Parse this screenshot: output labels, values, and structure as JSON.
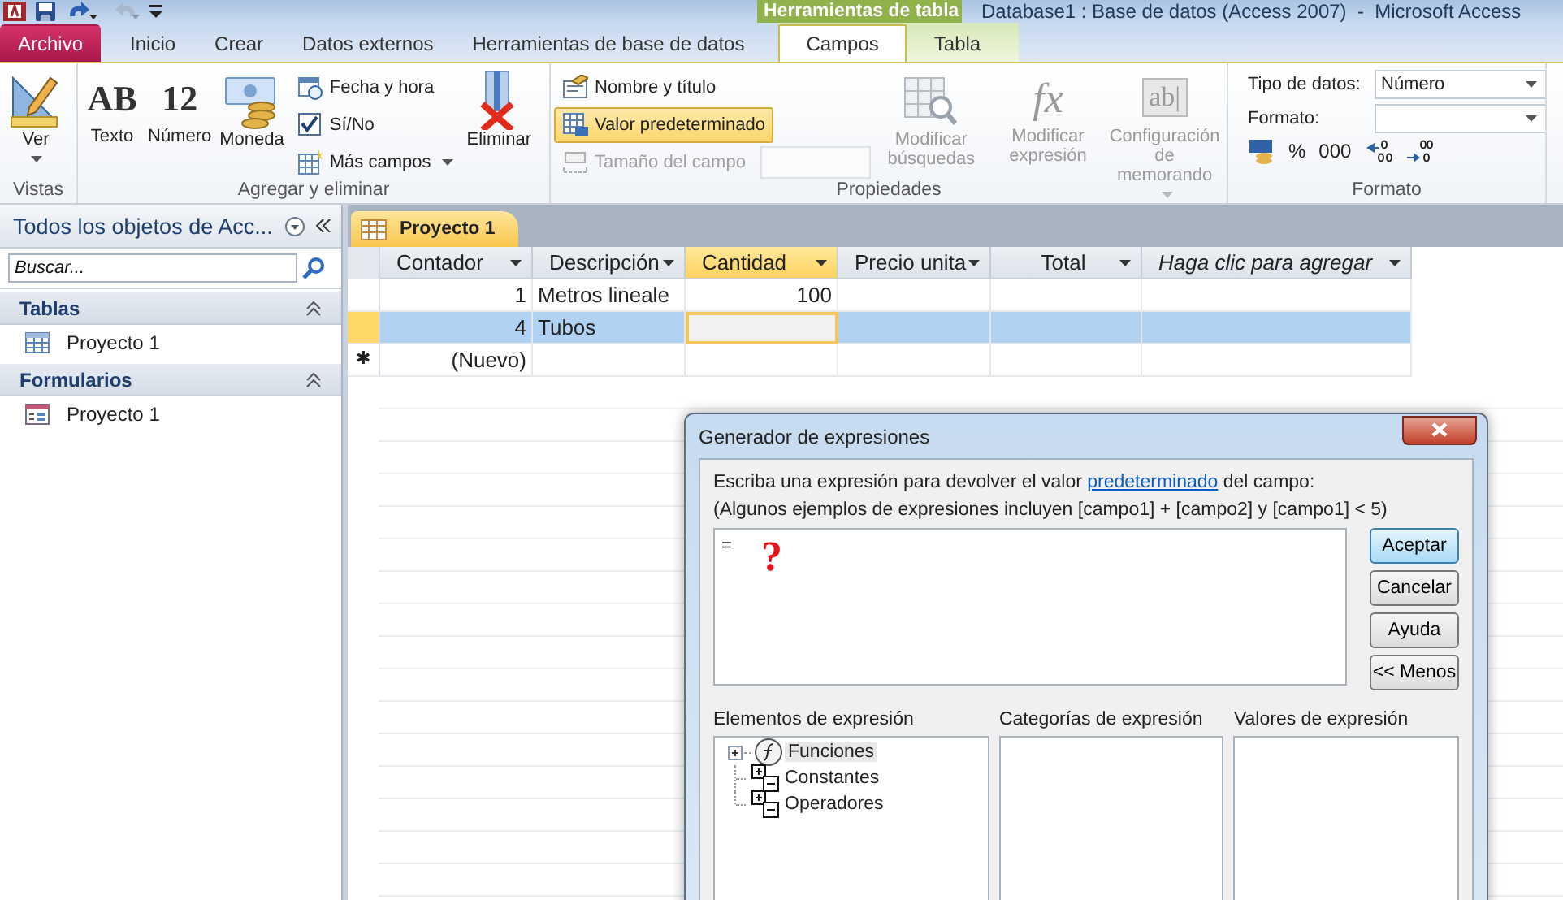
{
  "title_bar": {
    "contextual_tab": "Herramientas de tabla",
    "title": "Database1 : Base de datos (Access 2007)  -  Microsoft Access"
  },
  "ribbon_tabs": [
    {
      "label": "Archivo",
      "kind": "file",
      "selected": false
    },
    {
      "label": "Inicio",
      "kind": "normal",
      "selected": false
    },
    {
      "label": "Crear",
      "kind": "normal",
      "selected": false
    },
    {
      "label": "Datos externos",
      "kind": "normal",
      "selected": false
    },
    {
      "label": "Herramientas de base de datos",
      "kind": "normal",
      "selected": false
    },
    {
      "label": "Campos",
      "kind": "contextual",
      "selected": true
    },
    {
      "label": "Tabla",
      "kind": "contextual",
      "selected": false
    }
  ],
  "ribbon_groups": [
    {
      "label": "Vistas",
      "controls": [
        {
          "kind": "large",
          "label": "Ver",
          "dropdown": true,
          "disabled": false
        }
      ]
    },
    {
      "label": "Agregar y eliminar",
      "controls": [
        {
          "kind": "large",
          "label": "Texto",
          "glyph": "AB",
          "disabled": false
        },
        {
          "kind": "large",
          "label": "Número",
          "glyph": "12",
          "disabled": false
        },
        {
          "kind": "large",
          "label": "Moneda",
          "disabled": false
        },
        {
          "kind": "stack",
          "items": [
            {
              "label": "Fecha y hora",
              "pressed": false,
              "disabled": false
            },
            {
              "label": "Sí/No",
              "pressed": false,
              "disabled": false
            },
            {
              "label": "Más campos",
              "dropdown": true,
              "pressed": false,
              "disabled": false
            }
          ]
        },
        {
          "kind": "large",
          "label": "Eliminar",
          "disabled": false
        }
      ]
    },
    {
      "label": "Propiedades",
      "controls": [
        {
          "kind": "stack",
          "items": [
            {
              "label": "Nombre y título",
              "pressed": false,
              "disabled": false
            },
            {
              "label": "Valor predeterminado",
              "pressed": true,
              "disabled": false
            },
            {
              "label": "Tamaño del campo",
              "pressed": false,
              "disabled": true,
              "field": true
            }
          ]
        },
        {
          "kind": "large",
          "label": "Modificar búsquedas",
          "disabled": true
        },
        {
          "kind": "large",
          "label": "Modificar expresión",
          "glyph": "fx",
          "disabled": true
        },
        {
          "kind": "large",
          "label": "Configuración de memorando",
          "glyph": "ab|",
          "dropdown": true,
          "disabled": true
        }
      ]
    },
    {
      "label": "Formato",
      "controls": [
        {
          "kind": "format",
          "fields": [
            {
              "label": "Tipo de datos:",
              "value": "Número"
            },
            {
              "label": "Formato:"
            }
          ],
          "buttons": [
            {
              "kind": "currency"
            },
            {
              "kind": "text",
              "glyph": "%"
            },
            {
              "kind": "text",
              "glyph": "000"
            },
            {
              "kind": "decimals_more"
            },
            {
              "kind": "decimals_less"
            }
          ]
        }
      ]
    }
  ],
  "nav_pane": {
    "title": "Todos los objetos de Acc...",
    "search": {
      "placeholder": "Buscar..."
    },
    "sections": [
      {
        "label": "Tablas",
        "expanded": true,
        "items": [
          {
            "label": "Proyecto 1",
            "kind": "table"
          }
        ]
      },
      {
        "label": "Formularios",
        "expanded": true,
        "items": [
          {
            "label": "Proyecto 1",
            "kind": "form"
          }
        ]
      }
    ]
  },
  "document_tab": {
    "label": "Proyecto 1"
  },
  "table": {
    "columns": [
      {
        "label": "Contador",
        "kind": "number",
        "selected": false
      },
      {
        "label": "Descripción",
        "kind": "text",
        "selected": false
      },
      {
        "label": "Cantidad",
        "kind": "number",
        "selected": true
      },
      {
        "label": "Precio unita",
        "kind": "text",
        "selected": false
      },
      {
        "label": "Total",
        "kind": "center",
        "selected": false
      },
      {
        "label": "Haga clic para agregar",
        "kind": "add",
        "selected": false
      }
    ],
    "rows": [
      {
        "selected": false,
        "cells": [
          "1",
          "Metros lineale",
          "100",
          "",
          "",
          ""
        ]
      },
      {
        "selected": true,
        "cells": [
          "4",
          "Tubos",
          "",
          "",
          "",
          ""
        ]
      },
      {
        "selector": "✱",
        "selected": false,
        "cells": [
          "(Nuevo)",
          "",
          "",
          "",
          "",
          ""
        ]
      }
    ]
  },
  "dialog": {
    "title": "Generador de expresiones",
    "instruction": "Escriba una expresión para devolver el valor ",
    "link": "predeterminado",
    "instruction_end": " del campo:",
    "examples": "(Algunos ejemplos de expresiones incluyen [campo1] + [campo2] y [campo1] < 5)",
    "expression": "=",
    "annotation": "?",
    "buttons": [
      {
        "label": "Aceptar",
        "default": true
      },
      {
        "label": "Cancelar",
        "default": false
      },
      {
        "label": "Ayuda",
        "default": false
      },
      {
        "label": "<< Menos",
        "default": false
      }
    ],
    "panes": [
      {
        "label": "Elementos de expresión",
        "items": [
          {
            "label": "Funciones",
            "kind": "function",
            "expandable": true,
            "selected": true
          },
          {
            "label": "Constantes",
            "kind": "group",
            "expandable": false,
            "selected": false
          },
          {
            "label": "Operadores",
            "kind": "group",
            "expandable": false,
            "selected": false
          }
        ]
      },
      {
        "label": "Categorías de expresión"
      },
      {
        "label": "Valores de expresión"
      }
    ]
  }
}
